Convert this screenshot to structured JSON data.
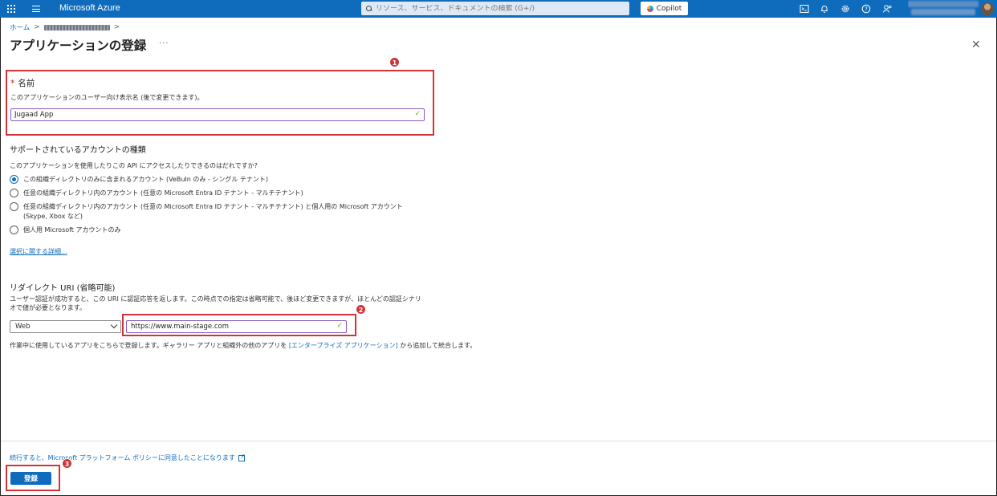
{
  "header": {
    "brand": "Microsoft Azure",
    "search_placeholder": "リソース、サービス、ドキュメントの検索 (G+/)",
    "copilot_label": "Copilot",
    "icons": [
      "cloud-shell-icon",
      "bell-icon",
      "gear-icon",
      "help-icon",
      "feedback-icon"
    ]
  },
  "breadcrumb": {
    "home": "ホーム",
    "sep": ">"
  },
  "page": {
    "title": "アプリケーションの登録",
    "more": "···",
    "close": "✕"
  },
  "name_section": {
    "required_mark": "*",
    "label": "名前",
    "description": "このアプリケーションのユーザー向け表示名 (後で変更できます)。",
    "value": "Jugaad App"
  },
  "account_types": {
    "heading": "サポートされているアカウントの種類",
    "question": "このアプリケーションを使用したりこの API にアクセスしたりできるのはだれですか?",
    "options": [
      {
        "label": "この組織ディレクトリのみに含まれるアカウント (VeBuIn のみ - シングル テナント)",
        "checked": true
      },
      {
        "label": "任意の組織ディレクトリ内のアカウント (任意の Microsoft Entra ID テナント - マルチテナント)",
        "checked": false
      },
      {
        "label": "任意の組織ディレクトリ内のアカウント (任意の Microsoft Entra ID テナント - マルチテナント) と個人用の Microsoft アカウント (Skype, Xbox など)",
        "checked": false
      },
      {
        "label": "個人用 Microsoft アカウントのみ",
        "checked": false
      }
    ],
    "help_link": "選択に関する詳細..."
  },
  "redirect": {
    "heading": "リダイレクト URI (省略可能)",
    "description": "ユーザー認証が成功すると、この URI に認証応答を返します。この時点での指定は省略可能で、後ほど変更できますが、ほとんどの認証シナリオで値が必要となります。",
    "platform": "Web",
    "uri": "https://www.main-stage.com",
    "enterprise_prefix": "作業中に使用しているアプリをこちらで登録します。ギャラリー アプリと組織外の他のアプリを",
    "enterprise_link": "[エンタープライズ アプリケーション]",
    "enterprise_suffix": " から追加して統合します。"
  },
  "footer": {
    "policy": "続行すると、Microsoft プラットフォーム ポリシーに同意したことになります",
    "register": "登録"
  },
  "annotations": {
    "b1": "1",
    "b2": "2",
    "b3": "3",
    "color": "#d13438"
  },
  "colors": {
    "brand_blue": "#0f6cbd",
    "focus_purple": "#8a5ac1",
    "valid_green": "#6bb700"
  }
}
